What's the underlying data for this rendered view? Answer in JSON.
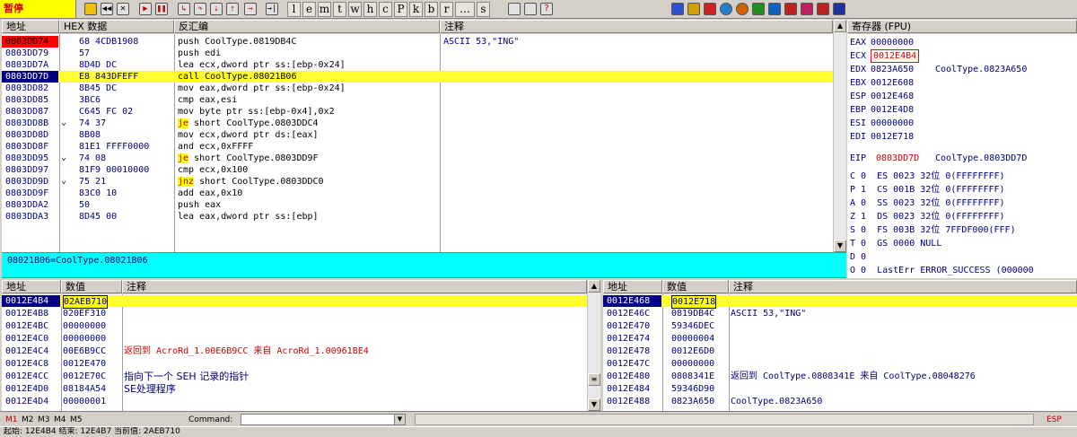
{
  "toolbar": {
    "status": "暂停",
    "letters": [
      "l",
      "e",
      "m",
      "t",
      "w",
      "h",
      "c",
      "P",
      "k",
      "b",
      "r",
      "...",
      "s"
    ]
  },
  "disasm": {
    "headers": {
      "addr": "地址",
      "hex": "HEX 数据",
      "asm": "反汇编",
      "comment": "注释"
    },
    "rows": [
      {
        "addr": "0803DD74",
        "hex": "68 4CDB1908",
        "asm": "push CoolType.0819DB4C",
        "comment": "ASCII 53,\"ING\"",
        "mark": "",
        "addr_style": "red"
      },
      {
        "addr": "0803DD79",
        "hex": "57",
        "asm": "push edi",
        "comment": "",
        "mark": ""
      },
      {
        "addr": "0803DD7A",
        "hex": "8D4D DC",
        "asm": "lea ecx,dword ptr ss:[ebp-0x24]",
        "comment": "",
        "mark": ""
      },
      {
        "addr": "0803DD7D",
        "hex": "E8 843DFEFF",
        "asm": "call CoolType.08021B06",
        "comment": "",
        "mark": "",
        "addr_style": "navy",
        "selected": true
      },
      {
        "addr": "0803DD82",
        "hex": "8B45 DC",
        "asm": "mov eax,dword ptr ss:[ebp-0x24]",
        "comment": "",
        "mark": ""
      },
      {
        "addr": "0803DD85",
        "hex": "3BC6",
        "asm": "cmp eax,esi",
        "comment": "",
        "mark": ""
      },
      {
        "addr": "0803DD87",
        "hex": "C645 FC 02",
        "asm": "mov byte ptr ss:[ebp-0x4],0x2",
        "comment": "",
        "mark": ""
      },
      {
        "addr": "0803DD8B",
        "hex": "74 37",
        "asm": "je short CoolType.0803DDC4",
        "comment": "",
        "mark": "⌄"
      },
      {
        "addr": "0803DD8D",
        "hex": "8B08",
        "asm": "mov ecx,dword ptr ds:[eax]",
        "comment": "",
        "mark": ""
      },
      {
        "addr": "0803DD8F",
        "hex": "81E1 FFFF0000",
        "asm": "and ecx,0xFFFF",
        "comment": "",
        "mark": ""
      },
      {
        "addr": "0803DD95",
        "hex": "74 08",
        "asm": "je short CoolType.0803DD9F",
        "comment": "",
        "mark": "⌄"
      },
      {
        "addr": "0803DD97",
        "hex": "81F9 00010000",
        "asm": "cmp ecx,0x100",
        "comment": "",
        "mark": ""
      },
      {
        "addr": "0803DD9D",
        "hex": "75 21",
        "asm": "jnz short CoolType.0803DDC0",
        "comment": "",
        "mark": "⌄"
      },
      {
        "addr": "0803DD9F",
        "hex": "83C0 10",
        "asm": "add eax,0x10",
        "comment": "",
        "mark": ""
      },
      {
        "addr": "0803DDA2",
        "hex": "50",
        "asm": "push eax",
        "comment": "",
        "mark": ""
      },
      {
        "addr": "0803DDA3",
        "hex": "8D45 00",
        "asm": "lea eax,dword ptr ss:[ebp]",
        "comment": "",
        "mark": ""
      }
    ],
    "info": "08021B06=CoolType.08021B06"
  },
  "registers": {
    "title": "寄存器 (FPU)",
    "gp": [
      {
        "name": "EAX",
        "value": "00000000",
        "comment": ""
      },
      {
        "name": "ECX",
        "value": "0012E4B4",
        "comment": "",
        "highlight": true
      },
      {
        "name": "EDX",
        "value": "0823A650",
        "comment": "CoolType.0823A650"
      },
      {
        "name": "EBX",
        "value": "0012E608",
        "comment": ""
      },
      {
        "name": "ESP",
        "value": "0012E468",
        "comment": ""
      },
      {
        "name": "EBP",
        "value": "0012E4D8",
        "comment": ""
      },
      {
        "name": "ESI",
        "value": "00000000",
        "comment": ""
      },
      {
        "name": "EDI",
        "value": "0012E718",
        "comment": ""
      }
    ],
    "eip": {
      "name": "EIP",
      "value": "0803DD7D",
      "comment": "CoolType.0803DD7D"
    },
    "flags": [
      "C 0  ES 0023 32位 0(FFFFFFFF)",
      "P 1  CS 001B 32位 0(FFFFFFFF)",
      "A 0  SS 0023 32位 0(FFFFFFFF)",
      "Z 1  DS 0023 32位 0(FFFFFFFF)",
      "S 0  FS 003B 32位 7FFDF000(FFF)",
      "T 0  GS 0000 NULL",
      "D 0",
      "O 0  LastErr ERROR_SUCCESS (000000"
    ]
  },
  "dump": {
    "headers": {
      "addr": "地址",
      "value": "数值",
      "comment": "注释"
    },
    "rows": [
      {
        "addr": "0012E4B4",
        "value": "02AEB710",
        "comment": "",
        "selected": true
      },
      {
        "addr": "0012E4B8",
        "value": "020EF310",
        "comment": ""
      },
      {
        "addr": "0012E4BC",
        "value": "00000000",
        "comment": ""
      },
      {
        "addr": "0012E4C0",
        "value": "00000000",
        "comment": ""
      },
      {
        "addr": "0012E4C4",
        "value": "00E6B9CC",
        "comment": "返回到 AcroRd_1.00E6B9CC 来自 AcroRd_1.00961BE4",
        "comment_style": "red"
      },
      {
        "addr": "0012E4C8",
        "value": "0012E470",
        "comment": ""
      },
      {
        "addr": "0012E4CC",
        "value": "0012E70C",
        "comment": "指向下一个 SEH 记录的指针"
      },
      {
        "addr": "0012E4D0",
        "value": "08184A54",
        "comment": "SE处理程序"
      },
      {
        "addr": "0012E4D4",
        "value": "00000001",
        "comment": ""
      }
    ]
  },
  "stack": {
    "headers": {
      "addr": "地址",
      "value": "数值",
      "comment": "注释"
    },
    "rows": [
      {
        "addr": "0012E468",
        "value": "0012E718",
        "comment": "",
        "selected": true
      },
      {
        "addr": "0012E46C",
        "value": "0819DB4C",
        "comment": "ASCII 53,\"ING\""
      },
      {
        "addr": "0012E470",
        "value": "59346DEC",
        "comment": ""
      },
      {
        "addr": "0012E474",
        "value": "00000004",
        "comment": ""
      },
      {
        "addr": "0012E478",
        "value": "0012E6D0",
        "comment": ""
      },
      {
        "addr": "0012E47C",
        "value": "00000000",
        "comment": ""
      },
      {
        "addr": "0012E480",
        "value": "0808341E",
        "comment": "返回到 CoolType.0808341E 来自 CoolType.08048276"
      },
      {
        "addr": "0012E484",
        "value": "59346D90",
        "comment": ""
      },
      {
        "addr": "0012E488",
        "value": "0823A650",
        "comment": "CoolType.0823A650"
      }
    ]
  },
  "cmdbar": {
    "markers": [
      "M1",
      "M2",
      "M3",
      "M4",
      "M5"
    ],
    "command_label": "Command:",
    "command_value": "",
    "reg_label": "ESP"
  },
  "statusbar": {
    "text": "起始: 12E4B4 结束: 12E4B7 当前值: 2AEB710"
  },
  "colors": {
    "jump_bg": "#ffff00",
    "jump_fg": "#c00000",
    "selected_row": "#ffff33",
    "info_bg": "#00ffff"
  }
}
